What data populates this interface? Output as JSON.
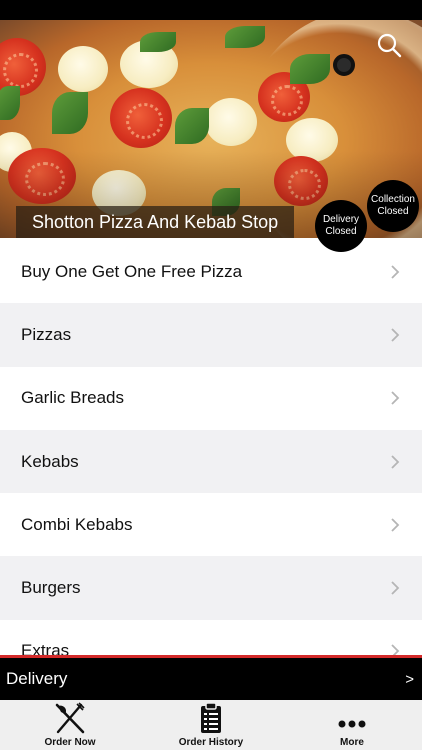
{
  "store": {
    "name": "Shotton Pizza And Kebab Stop"
  },
  "status": {
    "delivery": {
      "line1": "Delivery",
      "line2": "Closed"
    },
    "collection": {
      "line1": "Collection",
      "line2": "Closed"
    }
  },
  "icons": {
    "search": "search-icon",
    "chevron": "chevron-right-icon",
    "order_now": "fork-knife-icon",
    "order_history": "clipboard-list-icon",
    "more": "more-dots-icon"
  },
  "menu": {
    "items": [
      {
        "label": "Buy One Get One Free Pizza"
      },
      {
        "label": "Pizzas"
      },
      {
        "label": "Garlic Breads"
      },
      {
        "label": "Kebabs"
      },
      {
        "label": "Combi Kebabs"
      },
      {
        "label": "Burgers"
      },
      {
        "label": "Extras"
      }
    ]
  },
  "delivery_bar": {
    "label": "Delivery",
    "arrow": ">"
  },
  "tabs": [
    {
      "label": "Order Now"
    },
    {
      "label": "Order History"
    },
    {
      "label": "More"
    }
  ],
  "colors": {
    "accent_red": "#d32a2a",
    "bar_black": "#000000",
    "row_alt": "#f1f1f3"
  }
}
